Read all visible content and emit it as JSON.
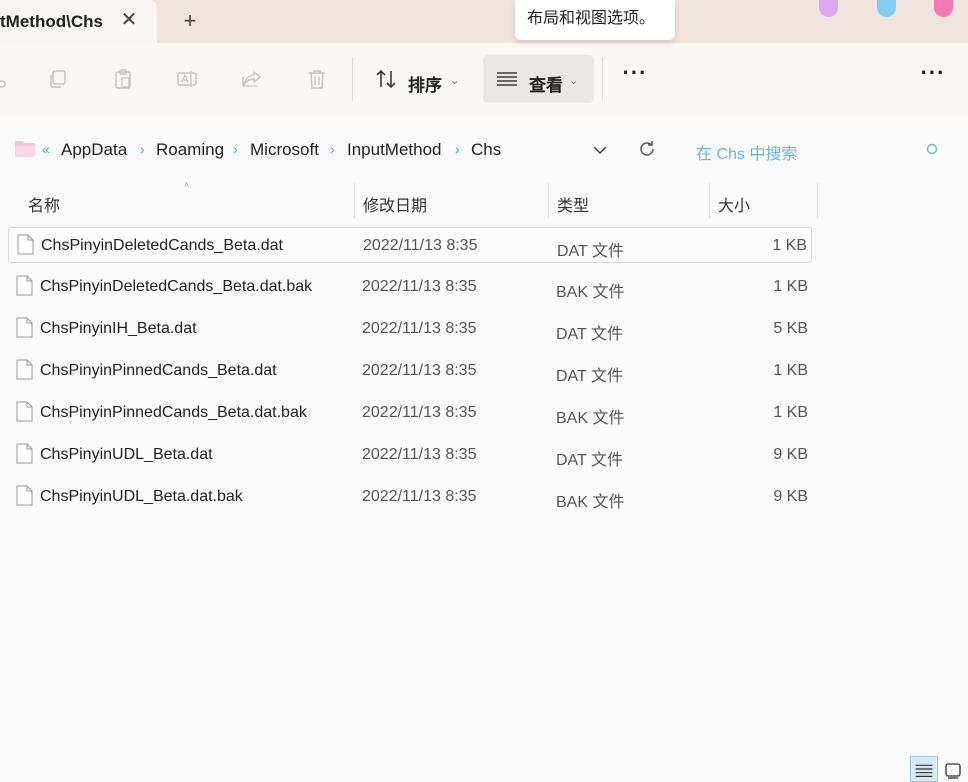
{
  "window": {
    "tab_title": "tMethod\\Chs",
    "close_glyph": "✕",
    "new_tab_glyph": "+",
    "tooltip": "布局和视图选项。",
    "accent_colors": [
      "#dba7ee",
      "#84cbf2",
      "#f178b3"
    ]
  },
  "toolbar": {
    "sort_label": "排序",
    "view_label": "查看",
    "more_glyph": "···",
    "icons": [
      "cut-icon",
      "copy-icon",
      "paste-icon",
      "rename-icon",
      "share-icon",
      "delete-icon"
    ]
  },
  "address": {
    "prefix": "«",
    "breadcrumbs": [
      "AppData",
      "Roaming",
      "Microsoft",
      "InputMethod",
      "Chs"
    ],
    "separator": "›",
    "search_placeholder": "在 Chs 中搜索"
  },
  "columns": {
    "name": "名称",
    "date": "修改日期",
    "type": "类型",
    "size": "大小"
  },
  "files": [
    {
      "name": "ChsPinyinDeletedCands_Beta.dat",
      "date": "2022/11/13 8:35",
      "type": "DAT 文件",
      "size": "1 KB",
      "selected": true
    },
    {
      "name": "ChsPinyinDeletedCands_Beta.dat.bak",
      "date": "2022/11/13 8:35",
      "type": "BAK 文件",
      "size": "1 KB"
    },
    {
      "name": "ChsPinyinIH_Beta.dat",
      "date": "2022/11/13 8:35",
      "type": "DAT 文件",
      "size": "5 KB"
    },
    {
      "name": "ChsPinyinPinnedCands_Beta.dat",
      "date": "2022/11/13 8:35",
      "type": "DAT 文件",
      "size": "1 KB"
    },
    {
      "name": "ChsPinyinPinnedCands_Beta.dat.bak",
      "date": "2022/11/13 8:35",
      "type": "BAK 文件",
      "size": "1 KB"
    },
    {
      "name": "ChsPinyinUDL_Beta.dat",
      "date": "2022/11/13 8:35",
      "type": "DAT 文件",
      "size": "9 KB"
    },
    {
      "name": "ChsPinyinUDL_Beta.dat.bak",
      "date": "2022/11/13 8:35",
      "type": "BAK 文件",
      "size": "9 KB"
    }
  ]
}
